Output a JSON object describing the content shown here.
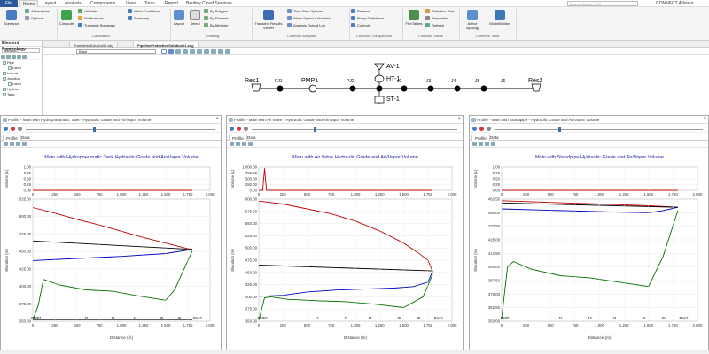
{
  "menu": {
    "file": "File",
    "tabs": [
      "Home",
      "Layout",
      "Analysis",
      "Components",
      "View",
      "Tools",
      "Report",
      "Bentley Cloud Services"
    ],
    "search_placeholder": "Search Ribbon (F3)",
    "account": "CONNECT Advisor"
  },
  "ribbon": {
    "scenarios": "Scenarios",
    "alternatives": "Alternatives",
    "options": "Options",
    "compute": "Compute",
    "validate": "Validate",
    "notifications": "Notifications",
    "transient_summary": "Transient Summary",
    "initial_conditions": "Initial Conditions",
    "summary": "Summary",
    "calculation_group": "Calculation",
    "layout": "Layout",
    "select": "Select",
    "by_polygon": "By Polygon",
    "by_element": "By Element",
    "by_attribute": "By Attribute",
    "drawing_group": "Drawing",
    "transient_results_viewer": "Transient Results Viewer",
    "time_step_options": "Time Step Options",
    "wave_speed_calculator": "Wave Speed Calculator",
    "analysis_output_log": "Analysis Output Log",
    "common_analysis_group": "Common Analysis",
    "patterns": "Patterns",
    "pump_definitions": "Pump Definitions",
    "controls": "Controls",
    "common_components_group": "Common Components",
    "flextables": "FlexTables",
    "selection_sets": "Selection Sets",
    "properties": "Properties",
    "refresh": "Refresh",
    "common_views_group": "Common Views",
    "active_topology": "Active Topology",
    "modelbuilder": "ModelBuilder",
    "common_tools_group": "Common Tools"
  },
  "sidebar": {
    "title": "Element Symbology",
    "combo": "<default>",
    "tree": [
      {
        "label": "Pipe",
        "indent": 0
      },
      {
        "label": "Label",
        "indent": 1
      },
      {
        "label": "Lateral",
        "indent": 0
      },
      {
        "label": "Junction",
        "indent": 0
      },
      {
        "label": "Label",
        "indent": 1
      },
      {
        "label": "Hydrant",
        "indent": 0
      },
      {
        "label": "Tank",
        "indent": 0
      }
    ]
  },
  "drawing": {
    "tabs": [
      "TransientsSolution01.wtg",
      "PipelineProtectionSolution01.wtg"
    ],
    "active_tab": 1,
    "layer_select": "Base",
    "labels": {
      "res1": "Res1",
      "pj1": "PJ1",
      "pmp1": "PMP1",
      "pj2": "PJ2",
      "av1": "AV-1",
      "ht1": "HT-1",
      "j2": "J2",
      "st1": "ST-1",
      "j3": "J3",
      "j4": "J4",
      "j5": "J5",
      "j6": "J6",
      "res2": "Res2"
    }
  },
  "panels": [
    {
      "title": "Profile - Main with Hydropneumatic Tank - Hydraulic Grade and Air/Vapor Volume",
      "tabs": [
        "Profile",
        "Data"
      ],
      "chart_data": {
        "type": "line",
        "title": "Main with Hydropneumatic Tank Hydraulic Grade and Air/Vapor Volume",
        "xlabel": "Distance (m)",
        "xlim": [
          0,
          2000
        ],
        "xticks": [
          "0",
          "250",
          "500",
          "750",
          "1,000",
          "1,250",
          "1,500",
          "1,750",
          "2,000"
        ],
        "top": {
          "ylabel": "Volume (L)",
          "ylim": [
            0,
            1.0
          ],
          "yticks": [
            "0.00",
            "0.25",
            "0.50",
            "0.75",
            "1.00"
          ],
          "series": [
            {
              "color": "#c00000",
              "x": [
                0,
                1800
              ],
              "y": [
                0,
                0
              ]
            }
          ]
        },
        "main": {
          "ylabel": "Elevation (m)",
          "ylim": [
            350,
            525
          ],
          "yticks": [
            "350.00",
            "375.00",
            "400.00",
            "425.00",
            "450.00",
            "475.00",
            "500.00",
            "525.00"
          ],
          "series": [
            {
              "color": "#c00000",
              "x": [
                0,
                250,
                500,
                750,
                1000,
                1250,
                1500,
                1750,
                1800
              ],
              "y": [
                513,
                505,
                496,
                488,
                479,
                470,
                462,
                454,
                453
              ]
            },
            {
              "color": "#000000",
              "x": [
                0,
                1800
              ],
              "y": [
                465,
                453
              ]
            },
            {
              "color": "#0000c0",
              "x": [
                0,
                500,
                1000,
                1500,
                1800
              ],
              "y": [
                437,
                440,
                443,
                447,
                453
              ]
            },
            {
              "color": "#007000",
              "x": [
                0,
                60,
                120,
                300,
                600,
                900,
                1200,
                1500,
                1600,
                1800
              ],
              "y": [
                352,
                372,
                410,
                402,
                395,
                393,
                386,
                380,
                395,
                451
              ]
            },
            {
              "color": "#000000",
              "x": [
                0,
                60,
                60,
                1800
              ],
              "y": [
                352,
                352,
                352,
                352
              ],
              "width": 0.6
            }
          ]
        },
        "node_labels": [
          {
            "label": "PMP1",
            "x": 40
          },
          {
            "label": "J2",
            "x": 600
          },
          {
            "label": "J3",
            "x": 900
          },
          {
            "label": "J4",
            "x": 1150
          },
          {
            "label": "J5",
            "x": 1450
          },
          {
            "label": "J6",
            "x": 1650
          },
          {
            "label": "Res2",
            "x": 1860
          }
        ]
      }
    },
    {
      "title": "Profile - Main with Air Valve - Hydraulic Grade and Air/Vapor Volume",
      "tabs": [
        "Profile",
        "Data"
      ],
      "chart_data": {
        "type": "line",
        "title": "Main with Air Valve Hydraulic Grade and Air/Vapor Volume",
        "xlabel": "Distance (m)",
        "xlim": [
          0,
          2000
        ],
        "xticks": [
          "0",
          "250",
          "500",
          "750",
          "1,000",
          "1,250",
          "1,500",
          "1,750",
          "2,000"
        ],
        "top": {
          "ylabel": "Volume (L)",
          "ylim": [
            0,
            1000
          ],
          "yticks": [
            "0.00",
            "250.00",
            "500.00",
            "750.00",
            "1,000.00"
          ],
          "series": [
            {
              "color": "#c00000",
              "x": [
                0,
                40,
                60,
                80,
                1800
              ],
              "y": [
                0,
                0,
                950,
                0,
                0
              ]
            }
          ]
        },
        "main": {
          "ylabel": "Elevation (m)",
          "ylim": [
            350,
            600
          ],
          "yticks": [
            "350.00",
            "375.00",
            "400.00",
            "425.00",
            "450.00",
            "475.00",
            "500.00",
            "525.00",
            "550.00",
            "575.00",
            "600.00"
          ],
          "series": [
            {
              "color": "#c00000",
              "x": [
                0,
                250,
                500,
                750,
                1000,
                1250,
                1500,
                1650,
                1750,
                1800
              ],
              "y": [
                596,
                590,
                580,
                570,
                555,
                535,
                510,
                490,
                475,
                452
              ]
            },
            {
              "color": "#000000",
              "x": [
                0,
                1800
              ],
              "y": [
                465,
                453
              ]
            },
            {
              "color": "#0000c0",
              "x": [
                0,
                250,
                500,
                800,
                1100,
                1400,
                1600,
                1750,
                1800
              ],
              "y": [
                401,
                403,
                410,
                414,
                416,
                418,
                421,
                430,
                452
              ]
            },
            {
              "color": "#007000",
              "x": [
                0,
                60,
                120,
                300,
                600,
                900,
                1200,
                1500,
                1700,
                1800
              ],
              "y": [
                352,
                398,
                400,
                395,
                392,
                390,
                385,
                378,
                400,
                446
              ]
            }
          ]
        },
        "node_labels": [
          {
            "label": "PMP1",
            "x": 40
          },
          {
            "label": "J2",
            "x": 600
          },
          {
            "label": "J3",
            "x": 900
          },
          {
            "label": "J4",
            "x": 1150
          },
          {
            "label": "J5",
            "x": 1450
          },
          {
            "label": "J6",
            "x": 1650
          },
          {
            "label": "Res2",
            "x": 1860
          }
        ]
      }
    },
    {
      "title": "Profile - Main with Standpipe - Hydraulic Grade and Air/Vapor Volume",
      "tabs": [
        "Profile",
        "Data"
      ],
      "chart_data": {
        "type": "line",
        "title": "Main with Standpipe Hydraulic Grade and Air/Vapor Volume",
        "xlabel": "Distance (m)",
        "xlim": [
          0,
          2000
        ],
        "xticks": [
          "0",
          "250",
          "500",
          "750",
          "1,000",
          "1,250",
          "1,500",
          "1,750",
          "2,000"
        ],
        "top": {
          "ylabel": "Volume (L)",
          "ylim": [
            0,
            1.0
          ],
          "yticks": [
            "0.00",
            "0.25",
            "0.50",
            "0.75",
            "1.00"
          ],
          "series": [
            {
              "color": "#c00000",
              "x": [
                0,
                1800
              ],
              "y": [
                0,
                0
              ]
            }
          ]
        },
        "main": {
          "ylabel": "Elevation (m)",
          "ylim": [
            350,
            462.5
          ],
          "yticks": [
            "350.00",
            "362.50",
            "375.00",
            "387.50",
            "400.00",
            "412.50",
            "425.00",
            "437.50",
            "450.00",
            "462.50"
          ],
          "series": [
            {
              "color": "#c00000",
              "x": [
                0,
                500,
                1000,
                1500,
                1800
              ],
              "y": [
                461,
                459.5,
                458,
                456.5,
                455
              ]
            },
            {
              "color": "#000000",
              "x": [
                0,
                1800
              ],
              "y": [
                459,
                455
              ]
            },
            {
              "color": "#0000c0",
              "x": [
                0,
                400,
                800,
                1200,
                1500,
                1650,
                1800
              ],
              "y": [
                453.5,
                452.5,
                451.5,
                450.5,
                450,
                452,
                455
              ]
            },
            {
              "color": "#007000",
              "x": [
                0,
                60,
                120,
                300,
                600,
                900,
                1200,
                1500,
                1650,
                1800
              ],
              "y": [
                352,
                400,
                405,
                398,
                392,
                390,
                386,
                382,
                410,
                452
              ]
            }
          ]
        },
        "node_labels": [
          {
            "label": "PMP1",
            "x": 40
          },
          {
            "label": "J2",
            "x": 600
          },
          {
            "label": "J3",
            "x": 900
          },
          {
            "label": "J4",
            "x": 1150
          },
          {
            "label": "J5",
            "x": 1450
          },
          {
            "label": "J6",
            "x": 1650
          },
          {
            "label": "Res2",
            "x": 1860
          }
        ]
      }
    }
  ]
}
